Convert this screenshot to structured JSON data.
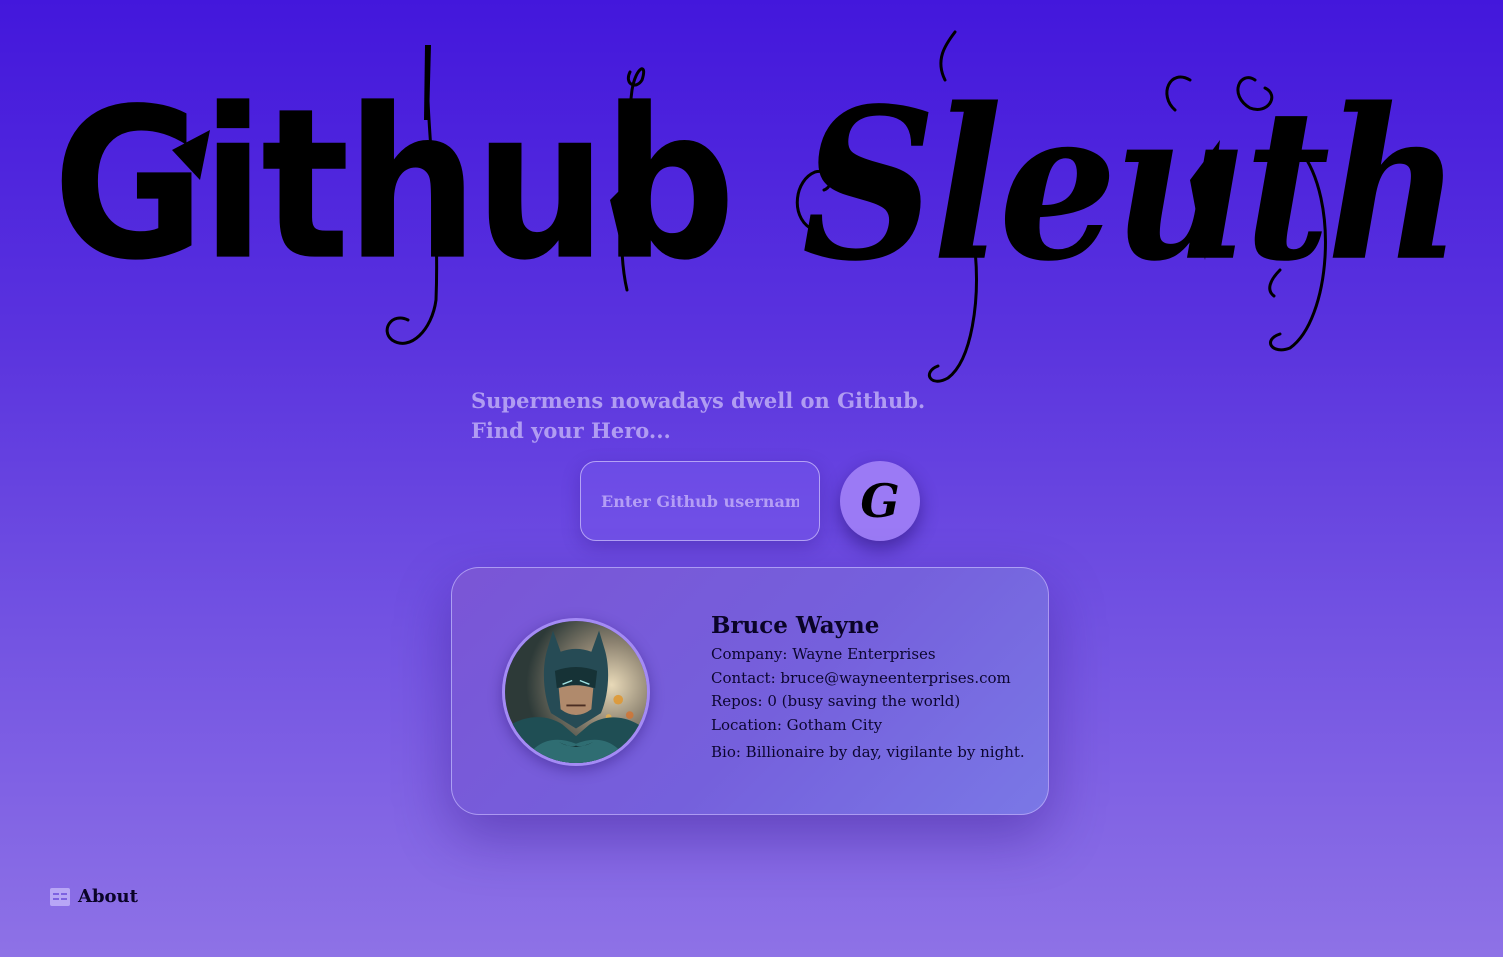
{
  "header": {
    "title_word_1": "Github",
    "title_word_2": "Sleuth",
    "tagline_line_1": "Supermens nowadays dwell on Github.",
    "tagline_line_2": "Find your Hero..."
  },
  "search": {
    "placeholder": "Enter Github username",
    "value": "",
    "button_glyph": "G"
  },
  "profile": {
    "name": "Bruce Wayne",
    "company": "Company: Wayne Enterprises",
    "contact": "Contact: bruce@wayneenterprises.com",
    "repos": "Repos: 0 (busy saving the world)",
    "location": "Location: Gotham City",
    "bio": "Bio: Billionaire by day, vigilante by night."
  },
  "footer": {
    "about_label": "About"
  },
  "icons": {
    "search_button": "github-g-icon",
    "about": "book-icon"
  },
  "colors": {
    "background_top": "#4317dc",
    "background_bottom": "#8e72e6",
    "tagline": "#b09cf2",
    "button": "#9b7af5",
    "card": "#7560dc"
  }
}
